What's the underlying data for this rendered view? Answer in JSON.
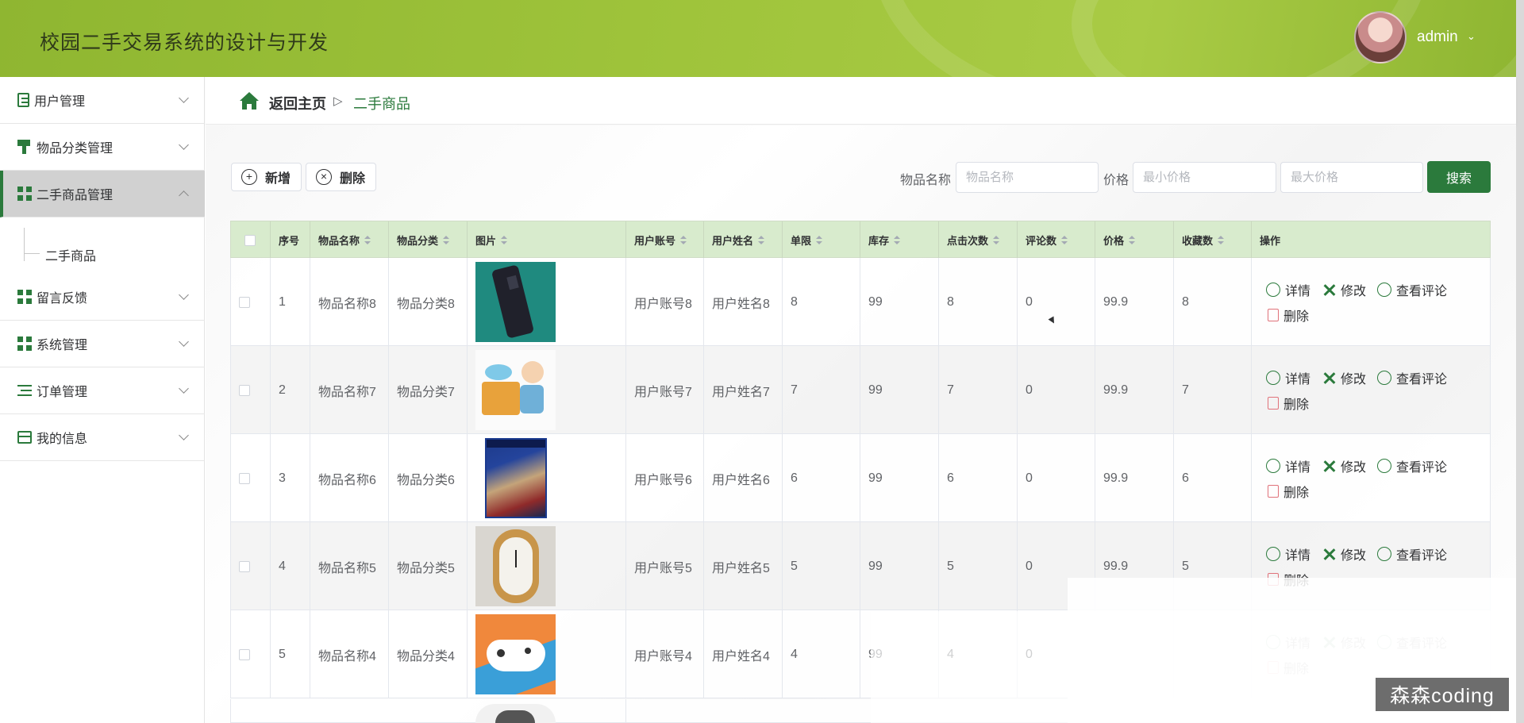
{
  "app": {
    "title": "校园二手交易系统的设计与开发",
    "user": "admin"
  },
  "sidebar": {
    "items": [
      {
        "label": "用户管理",
        "icon": "clipboard-icon",
        "expanded": false
      },
      {
        "label": "物品分类管理",
        "icon": "brush-icon",
        "expanded": false
      },
      {
        "label": "二手商品管理",
        "icon": "grid-icon",
        "expanded": true
      },
      {
        "label": "留言反馈",
        "icon": "grid-icon",
        "expanded": false
      },
      {
        "label": "系统管理",
        "icon": "grid-icon",
        "expanded": false
      },
      {
        "label": "订单管理",
        "icon": "list-icon",
        "expanded": false
      },
      {
        "label": "我的信息",
        "icon": "card-icon",
        "expanded": false
      }
    ],
    "submenu": {
      "label": "二手商品"
    }
  },
  "breadcrumb": {
    "home": "返回主页",
    "separator": "▷",
    "current": "二手商品"
  },
  "toolbar": {
    "add_label": "新增",
    "delete_label": "删除"
  },
  "search": {
    "name_label": "物品名称",
    "name_placeholder": "物品名称",
    "price_label": "价格",
    "min_placeholder": "最小价格",
    "max_placeholder": "最大价格",
    "button_label": "搜索"
  },
  "table": {
    "headers": [
      "序号",
      "物品名称",
      "物品分类",
      "图片",
      "用户账号",
      "用户姓名",
      "单限",
      "库存",
      "点击次数",
      "评论数",
      "价格",
      "收藏数",
      "操作"
    ],
    "rows": [
      {
        "no": "1",
        "name": "物品名称8",
        "category": "物品分类8",
        "image": "usb-drive",
        "account": "用户账号8",
        "username": "用户姓名8",
        "limit": "8",
        "stock": "99",
        "clicks": "8",
        "comments": "0",
        "price": "99.9",
        "favorites": "8"
      },
      {
        "no": "2",
        "name": "物品名称7",
        "category": "物品分类7",
        "image": "cartoon-boy",
        "account": "用户账号7",
        "username": "用户姓名7",
        "limit": "7",
        "stock": "99",
        "clicks": "7",
        "comments": "0",
        "price": "99.9",
        "favorites": "7"
      },
      {
        "no": "3",
        "name": "物品名称6",
        "category": "物品分类6",
        "image": "game-box",
        "account": "用户账号6",
        "username": "用户姓名6",
        "limit": "6",
        "stock": "99",
        "clicks": "6",
        "comments": "0",
        "price": "99.9",
        "favorites": "6"
      },
      {
        "no": "4",
        "name": "物品名称5",
        "category": "物品分类5",
        "image": "gold-watch",
        "account": "用户账号5",
        "username": "用户姓名5",
        "limit": "5",
        "stock": "99",
        "clicks": "5",
        "comments": "0",
        "price": "99.9",
        "favorites": "5"
      },
      {
        "no": "5",
        "name": "物品名称4",
        "category": "物品分类4",
        "image": "game-controller",
        "account": "用户账号4",
        "username": "用户姓名4",
        "limit": "4",
        "stock": "99",
        "clicks": "4",
        "comments": "0",
        "price": "",
        "favorites": ""
      }
    ],
    "actions": {
      "detail": "详情",
      "edit": "修改",
      "comments": "查看评论",
      "delete": "删除"
    }
  },
  "watermark": "森森coding",
  "colors": {
    "brand": "#2b7a3c",
    "header": "#9fc43b",
    "table_header": "#d8ebcd"
  }
}
